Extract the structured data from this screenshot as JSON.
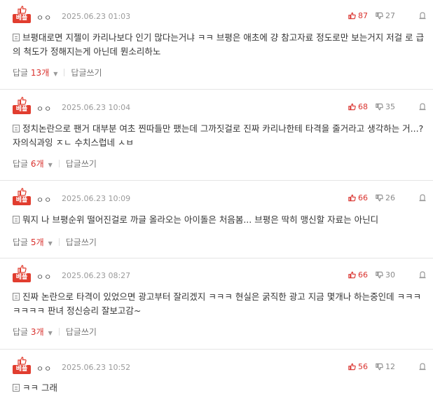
{
  "badge_label": "베플",
  "reply_label": "답글",
  "reply_unit": "개",
  "write_reply_label": "답글쓰기",
  "colors": {
    "accent": "#e13d2f",
    "upvote": "#d9302c"
  },
  "comments": [
    {
      "author": "ㅇㅇ",
      "date": "2025.06.23 01:03",
      "upvotes": "87",
      "downvotes": "27",
      "text": "브평대로면 지젤이 카리나보다 인기 많다는거냐 ㅋㅋ 브평은 애초에 걍 참고자료 정도로만 보는거지 저걸 로 급의 척도가 정해지는게 아닌데 뭔소리하노",
      "reply_count": "13"
    },
    {
      "author": "ㅇㅇ",
      "date": "2025.06.23 10:04",
      "upvotes": "68",
      "downvotes": "35",
      "text": "정치논란으로 팬거 대부분 여초 찐따들만 팼는데 그까짓걸로 진짜 카리나한테 타격을 줄거라고 생각하는 거...? 자의식과잉 ㅈㄴ 수치스럽네 ㅅㅂ",
      "reply_count": "6"
    },
    {
      "author": "ㅇㅇ",
      "date": "2025.06.23 10:09",
      "upvotes": "66",
      "downvotes": "26",
      "text": "뭐지 나 브평순위 떨어진걸로 까글 올라오는 아이돌은 처음봄... 브평은 딱히 맹신할 자료는 아닌디",
      "reply_count": "5"
    },
    {
      "author": "ㅇㅇ",
      "date": "2025.06.23 08:27",
      "upvotes": "66",
      "downvotes": "30",
      "text": "진짜 논란으로 타격이 있었으면 광고부터 잘리겠지 ㅋㅋㅋ 현실은 굵직한 광고 지금 몇개나 하는중인데 ㅋㅋㅋㅋㅋㅋㅋ 판녀 정신승리 잘보고감~",
      "reply_count": "3"
    },
    {
      "author": "ㅇㅇ",
      "date": "2025.06.23 10:52",
      "upvotes": "56",
      "downvotes": "12",
      "text": "ㅋㅋ 그래",
      "reply_count": ""
    }
  ]
}
